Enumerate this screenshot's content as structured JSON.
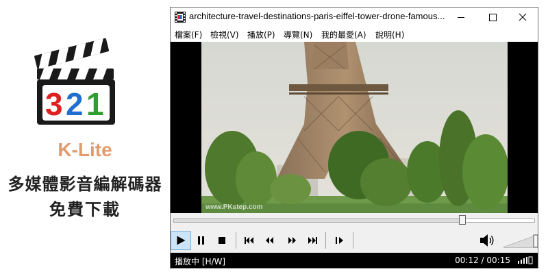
{
  "promo": {
    "brand_name": "K-Lite",
    "line1": "多媒體影音編解碼器",
    "line2": "免費下載",
    "logo_text": "321",
    "colors": {
      "brand": "#e39a6c",
      "digit3": "#e02020",
      "digit2": "#1e6fd0",
      "digit1": "#2f9e2f"
    }
  },
  "window": {
    "title": "architecture-travel-destinations-paris-eiffel-tower-drone-famous...",
    "icons": {
      "app": "mpc-film-icon",
      "minimize": "minimize-icon",
      "maximize": "maximize-icon",
      "close": "close-icon"
    }
  },
  "menu": {
    "items": [
      {
        "label": "檔案(F)"
      },
      {
        "label": "檢視(V)"
      },
      {
        "label": "播放(P)"
      },
      {
        "label": "導覽(N)"
      },
      {
        "label": "我的最愛(A)"
      },
      {
        "label": "說明(H)"
      }
    ]
  },
  "video": {
    "watermark": "www.PKstep.com"
  },
  "playback": {
    "position_fraction": 0.8,
    "volume_fraction": 1.0
  },
  "controls": {
    "icons": [
      "play-icon",
      "pause-icon",
      "stop-icon",
      "skip-back-icon",
      "rewind-icon",
      "fast-forward-icon",
      "skip-forward-icon",
      "frame-step-icon",
      "volume-icon"
    ]
  },
  "status": {
    "state": "播放中 [H/W]",
    "time": "00:12 / 00:15"
  }
}
